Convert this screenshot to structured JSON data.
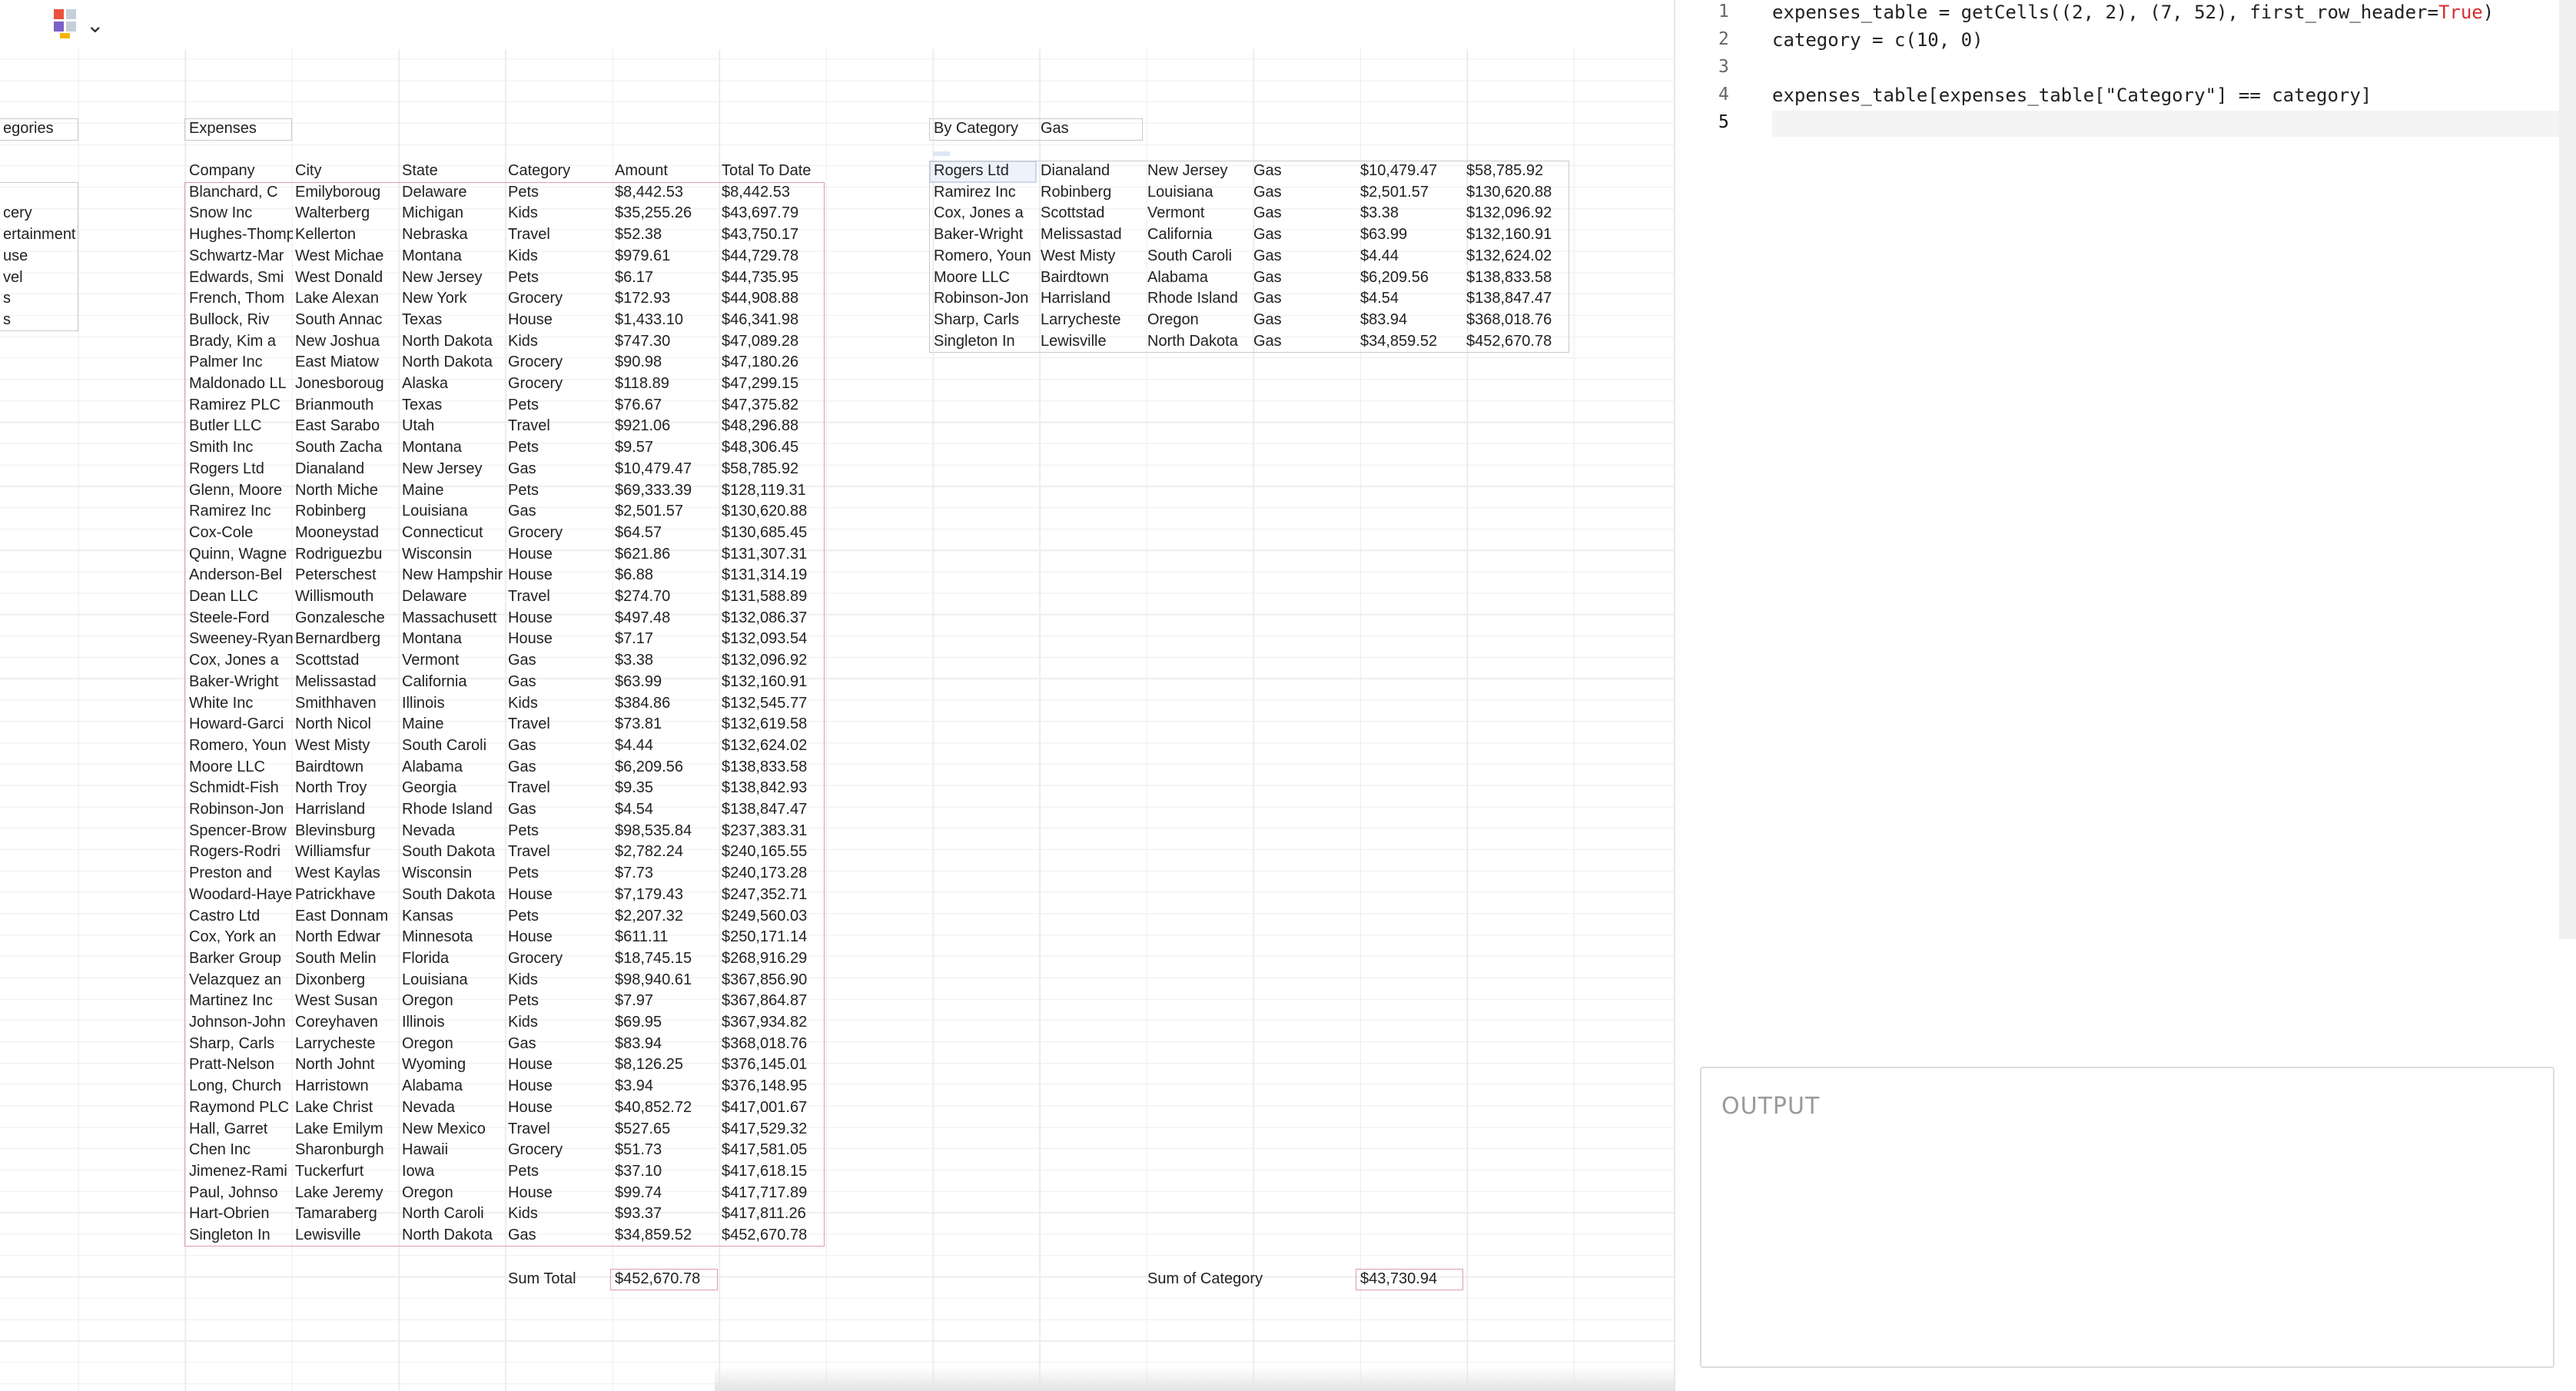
{
  "toolbar": {
    "logo_icon": "grid-logo-icon",
    "chevron_icon": "chevron-down-icon",
    "logo_colors": [
      "#e8523f",
      "#c6cfd8",
      "#f7b500",
      "#7b61c6"
    ]
  },
  "categories_panel": {
    "title": "egories",
    "items": [
      "",
      "cery",
      "ertainment",
      "use",
      "vel",
      "s",
      "s"
    ]
  },
  "expenses": {
    "title": "Expenses",
    "headers": [
      "Company",
      "City",
      "State",
      "Category",
      "Amount",
      "Total To Date"
    ],
    "rows": [
      [
        "Blanchard, C",
        "Emilyboroug",
        "Delaware",
        "Pets",
        "$8,442.53",
        "$8,442.53"
      ],
      [
        "Snow Inc",
        "Walterberg",
        "Michigan",
        "Kids",
        "$35,255.26",
        "$43,697.79"
      ],
      [
        "Hughes-Thomp",
        "Kellerton",
        "Nebraska",
        "Travel",
        "$52.38",
        "$43,750.17"
      ],
      [
        "Schwartz-Mar",
        "West Michae",
        "Montana",
        "Kids",
        "$979.61",
        "$44,729.78"
      ],
      [
        "Edwards, Smi",
        "West Donald",
        "New Jersey",
        "Pets",
        "$6.17",
        "$44,735.95"
      ],
      [
        "French, Thom",
        "Lake Alexan",
        "New York",
        "Grocery",
        "$172.93",
        "$44,908.88"
      ],
      [
        "Bullock, Riv",
        "South Annac",
        "Texas",
        "House",
        "$1,433.10",
        "$46,341.98"
      ],
      [
        "Brady, Kim a",
        "New Joshua",
        "North Dakota",
        "Kids",
        "$747.30",
        "$47,089.28"
      ],
      [
        "Palmer Inc",
        "East Miatow",
        "North Dakota",
        "Grocery",
        "$90.98",
        "$47,180.26"
      ],
      [
        "Maldonado LL",
        "Jonesboroug",
        "Alaska",
        "Grocery",
        "$118.89",
        "$47,299.15"
      ],
      [
        "Ramirez PLC",
        "Brianmouth",
        "Texas",
        "Pets",
        "$76.67",
        "$47,375.82"
      ],
      [
        "Butler LLC",
        "East Sarabo",
        "Utah",
        "Travel",
        "$921.06",
        "$48,296.88"
      ],
      [
        "Smith Inc",
        "South Zacha",
        "Montana",
        "Pets",
        "$9.57",
        "$48,306.45"
      ],
      [
        "Rogers Ltd",
        "Dianaland",
        "New Jersey",
        "Gas",
        "$10,479.47",
        "$58,785.92"
      ],
      [
        "Glenn, Moore",
        "North Miche",
        "Maine",
        "Pets",
        "$69,333.39",
        "$128,119.31"
      ],
      [
        "Ramirez Inc",
        "Robinberg",
        "Louisiana",
        "Gas",
        "$2,501.57",
        "$130,620.88"
      ],
      [
        "Cox-Cole",
        "Mooneystad",
        "Connecticut",
        "Grocery",
        "$64.57",
        "$130,685.45"
      ],
      [
        "Quinn, Wagne",
        "Rodriguezbu",
        "Wisconsin",
        "House",
        "$621.86",
        "$131,307.31"
      ],
      [
        "Anderson-Bel",
        "Peterschest",
        "New Hampshir",
        "House",
        "$6.88",
        "$131,314.19"
      ],
      [
        "Dean LLC",
        "Willismouth",
        "Delaware",
        "Travel",
        "$274.70",
        "$131,588.89"
      ],
      [
        "Steele-Ford",
        "Gonzalesche",
        "Massachusett",
        "House",
        "$497.48",
        "$132,086.37"
      ],
      [
        "Sweeney-Ryan",
        "Bernardberg",
        "Montana",
        "House",
        "$7.17",
        "$132,093.54"
      ],
      [
        "Cox, Jones a",
        "Scottstad",
        "Vermont",
        "Gas",
        "$3.38",
        "$132,096.92"
      ],
      [
        "Baker-Wright",
        "Melissastad",
        "California",
        "Gas",
        "$63.99",
        "$132,160.91"
      ],
      [
        "White Inc",
        "Smithhaven",
        "Illinois",
        "Kids",
        "$384.86",
        "$132,545.77"
      ],
      [
        "Howard-Garci",
        "North Nicol",
        "Maine",
        "Travel",
        "$73.81",
        "$132,619.58"
      ],
      [
        "Romero, Youn",
        "West Misty",
        "South Caroli",
        "Gas",
        "$4.44",
        "$132,624.02"
      ],
      [
        "Moore LLC",
        "Bairdtown",
        "Alabama",
        "Gas",
        "$6,209.56",
        "$138,833.58"
      ],
      [
        "Schmidt-Fish",
        "North Troy",
        "Georgia",
        "Travel",
        "$9.35",
        "$138,842.93"
      ],
      [
        "Robinson-Jon",
        "Harrisland",
        "Rhode Island",
        "Gas",
        "$4.54",
        "$138,847.47"
      ],
      [
        "Spencer-Brow",
        "Blevinsburg",
        "Nevada",
        "Pets",
        "$98,535.84",
        "$237,383.31"
      ],
      [
        "Rogers-Rodri",
        "Williamsfur",
        "South Dakota",
        "Travel",
        "$2,782.24",
        "$240,165.55"
      ],
      [
        "Preston and",
        "West Kaylas",
        "Wisconsin",
        "Pets",
        "$7.73",
        "$240,173.28"
      ],
      [
        "Woodard-Haye",
        "Patrickhave",
        "South Dakota",
        "House",
        "$7,179.43",
        "$247,352.71"
      ],
      [
        "Castro Ltd",
        "East Donnam",
        "Kansas",
        "Pets",
        "$2,207.32",
        "$249,560.03"
      ],
      [
        "Cox, York an",
        "North Edwar",
        "Minnesota",
        "House",
        "$611.11",
        "$250,171.14"
      ],
      [
        "Barker Group",
        "South Melin",
        "Florida",
        "Grocery",
        "$18,745.15",
        "$268,916.29"
      ],
      [
        "Velazquez an",
        "Dixonberg",
        "Louisiana",
        "Kids",
        "$98,940.61",
        "$367,856.90"
      ],
      [
        "Martinez Inc",
        "West Susan",
        "Oregon",
        "Pets",
        "$7.97",
        "$367,864.87"
      ],
      [
        "Johnson-John",
        "Coreyhaven",
        "Illinois",
        "Kids",
        "$69.95",
        "$367,934.82"
      ],
      [
        "Sharp, Carls",
        "Larrycheste",
        "Oregon",
        "Gas",
        "$83.94",
        "$368,018.76"
      ],
      [
        "Pratt-Nelson",
        "North Johnt",
        "Wyoming",
        "House",
        "$8,126.25",
        "$376,145.01"
      ],
      [
        "Long, Church",
        "Harristown",
        "Alabama",
        "House",
        "$3.94",
        "$376,148.95"
      ],
      [
        "Raymond PLC",
        "Lake Christ",
        "Nevada",
        "House",
        "$40,852.72",
        "$417,001.67"
      ],
      [
        "Hall, Garret",
        "Lake Emilym",
        "New Mexico",
        "Travel",
        "$527.65",
        "$417,529.32"
      ],
      [
        "Chen Inc",
        "Sharonburgh",
        "Hawaii",
        "Grocery",
        "$51.73",
        "$417,581.05"
      ],
      [
        "Jimenez-Rami",
        "Tuckerfurt",
        "Iowa",
        "Pets",
        "$37.10",
        "$417,618.15"
      ],
      [
        "Paul, Johnso",
        "Lake Jeremy",
        "Oregon",
        "House",
        "$99.74",
        "$417,717.89"
      ],
      [
        "Hart-Obrien",
        "Tamaraberg",
        "North Caroli",
        "Kids",
        "$93.37",
        "$417,811.26"
      ],
      [
        "Singleton In",
        "Lewisville",
        "North Dakota",
        "Gas",
        "$34,859.52",
        "$452,670.78"
      ]
    ],
    "sum_label": "Sum Total",
    "sum_value": "$452,670.78"
  },
  "by_category": {
    "title": "By Category",
    "selected": "Gas",
    "rows": [
      [
        "Rogers Ltd",
        "Dianaland",
        "New Jersey",
        "Gas",
        "$10,479.47",
        "$58,785.92"
      ],
      [
        "Ramirez Inc",
        "Robinberg",
        "Louisiana",
        "Gas",
        "$2,501.57",
        "$130,620.88"
      ],
      [
        "Cox, Jones a",
        "Scottstad",
        "Vermont",
        "Gas",
        "$3.38",
        "$132,096.92"
      ],
      [
        "Baker-Wright",
        "Melissastad",
        "California",
        "Gas",
        "$63.99",
        "$132,160.91"
      ],
      [
        "Romero, Youn",
        "West Misty",
        "South Caroli",
        "Gas",
        "$4.44",
        "$132,624.02"
      ],
      [
        "Moore LLC",
        "Bairdtown",
        "Alabama",
        "Gas",
        "$6,209.56",
        "$138,833.58"
      ],
      [
        "Robinson-Jon",
        "Harrisland",
        "Rhode Island",
        "Gas",
        "$4.54",
        "$138,847.47"
      ],
      [
        "Sharp, Carls",
        "Larrycheste",
        "Oregon",
        "Gas",
        "$83.94",
        "$368,018.76"
      ],
      [
        "Singleton In",
        "Lewisville",
        "North Dakota",
        "Gas",
        "$34,859.52",
        "$452,670.78"
      ]
    ],
    "sum_label": "Sum of Category",
    "sum_value": "$43,730.94"
  },
  "editor": {
    "line_numbers": [
      "1",
      "2",
      "3",
      "4",
      "5"
    ],
    "lines": [
      {
        "pre": "expenses_table = getCells((2, 2), (7, 52), first_row_header=",
        "kw": "True",
        "post": ")"
      },
      {
        "pre": "category = c(10, 0)",
        "kw": "",
        "post": ""
      },
      {
        "pre": "",
        "kw": "",
        "post": ""
      },
      {
        "pre": "expenses_table[expenses_table[\"Category\"] == category]",
        "kw": "",
        "post": ""
      },
      {
        "pre": "",
        "kw": "",
        "post": ""
      }
    ],
    "keyword_color": "#d32f2f"
  },
  "output": {
    "title": "OUTPUT"
  }
}
